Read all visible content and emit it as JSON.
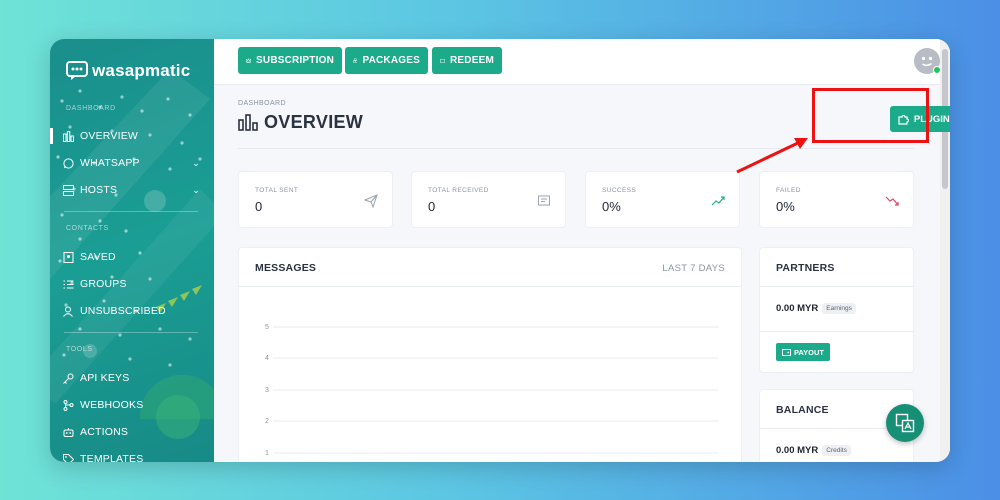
{
  "brand": {
    "name": "wasapmatic"
  },
  "sidebar": {
    "sections": {
      "dashboard": "DASHBOARD",
      "contacts": "CONTACTS",
      "tools": "TOOLS"
    },
    "items": [
      {
        "label": "OVERVIEW",
        "icon": "chart-icon"
      },
      {
        "label": "WHATSAPP",
        "icon": "whatsapp-icon"
      },
      {
        "label": "HOSTS",
        "icon": "server-icon"
      },
      {
        "label": "SAVED",
        "icon": "address-book-icon"
      },
      {
        "label": "GROUPS",
        "icon": "list-icon"
      },
      {
        "label": "UNSUBSCRIBED",
        "icon": "user-off-icon"
      },
      {
        "label": "API KEYS",
        "icon": "key-icon"
      },
      {
        "label": "WEBHOOKS",
        "icon": "webhook-icon"
      },
      {
        "label": "ACTIONS",
        "icon": "robot-icon"
      },
      {
        "label": "TEMPLATES",
        "icon": "tag-icon"
      }
    ]
  },
  "topbar": {
    "subscription": "SUBSCRIPTION",
    "packages": "PACKAGES",
    "redeem": "REDEEM"
  },
  "page": {
    "breadcrumb": "DASHBOARD",
    "title": "OVERVIEW",
    "plugins_button": "PLUGINS"
  },
  "stats": [
    {
      "label": "TOTAL SENT",
      "value": "0",
      "icon": "send-icon",
      "color": "#9aa3b1"
    },
    {
      "label": "TOTAL RECEIVED",
      "value": "0",
      "icon": "message-icon",
      "color": "#9aa3b1"
    },
    {
      "label": "SUCCESS",
      "value": "0%",
      "icon": "trend-up-icon",
      "color": "#22b07d"
    },
    {
      "label": "FAILED",
      "value": "0%",
      "icon": "trend-down-icon",
      "color": "#e0455a"
    }
  ],
  "messages": {
    "title": "MESSAGES",
    "range": "LAST 7 DAYS",
    "y_ticks": [
      "5",
      "4",
      "3",
      "2",
      "1"
    ]
  },
  "partners": {
    "title": "PARTNERS",
    "amount": "0.00 MYR",
    "tag": "Earnings",
    "payout": "PAYOUT"
  },
  "balance": {
    "title": "BALANCE",
    "amount": "0.00 MYR",
    "tag": "Credits"
  },
  "colors": {
    "accent": "#1bab8b",
    "sidebar": "#1a9e94",
    "highlight": "#ee1111"
  }
}
